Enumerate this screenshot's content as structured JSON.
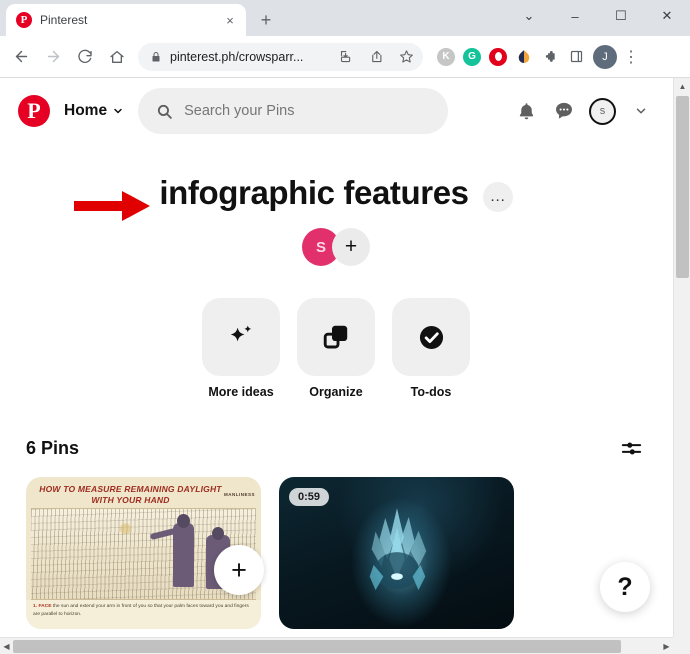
{
  "browser": {
    "tab": {
      "title": "Pinterest",
      "favicon": "pinterest-icon",
      "close": "×"
    },
    "new_tab": "+",
    "window_controls": {
      "minimize_all": "⌄",
      "minimize": "–",
      "maximize": "☐",
      "close": "✕"
    },
    "toolbar": {
      "back": "←",
      "forward": "→",
      "reload": "⟳",
      "home": "⌂",
      "lock_icon": "lock-icon",
      "url": "pinterest.ph/crowsparr...",
      "install_icon": "install-icon",
      "share_icon": "share-icon",
      "bookmark_icon": "star-icon",
      "extensions": [
        {
          "name": "kaspersky",
          "letter": "K",
          "color": "#c6c6c6"
        },
        {
          "name": "grammarly",
          "letter": "G",
          "color": "#15c39a"
        },
        {
          "name": "opera-gx",
          "letter": "O",
          "color": "#e3001b"
        },
        {
          "name": "honey",
          "letter": "",
          "color": "#f2a33c"
        },
        {
          "name": "puzzle",
          "letter": "",
          "color": "#5f6368"
        },
        {
          "name": "sidepanel",
          "letter": "",
          "color": "#5f6368"
        }
      ],
      "profile_letter": "J",
      "menu": "⋮"
    }
  },
  "pinterest": {
    "logo": "pinterest-logo",
    "home_label": "Home",
    "search": {
      "placeholder": "Search your Pins",
      "icon": "search-icon"
    },
    "header_actions": {
      "notifications": "bell-icon",
      "messages": "chat-icon",
      "avatar_letter": "s",
      "account_chevron": "⌄"
    },
    "board": {
      "title": "infographic features",
      "menu_label": "…",
      "collaborator_avatar_letter": "S",
      "add_collaborator": "+",
      "avatar_color": "#e1306c"
    },
    "action_tiles": [
      {
        "label": "More ideas",
        "icon": "sparkle-icon"
      },
      {
        "label": "Organize",
        "icon": "organize-icon"
      },
      {
        "label": "To-dos",
        "icon": "check-circle-icon"
      }
    ],
    "pins_section": {
      "count_label": "6 Pins",
      "filter_icon": "filter-sliders-icon",
      "create_button": "+"
    },
    "pins": [
      {
        "type": "infographic",
        "title": "HOW TO MEASURE REMAINING DAYLIGHT WITH YOUR HAND",
        "brand": "MANLINESS",
        "caption_bold": "1. FACE",
        "caption": " the sun and extend your arm in front of you so that your palm faces toward you and fingers are parallel to horizon."
      },
      {
        "type": "video",
        "duration": "0:59",
        "alt": "glowing blue creature"
      }
    ],
    "help_button": "?"
  },
  "scrollbars": {
    "vertical_up": "▲",
    "vertical_down": "▼",
    "horizontal_left": "◀",
    "horizontal_right": "▶"
  },
  "colors": {
    "pinterest_red": "#e60023",
    "accent_pink": "#e1306c",
    "annotation_red": "#e00000"
  }
}
